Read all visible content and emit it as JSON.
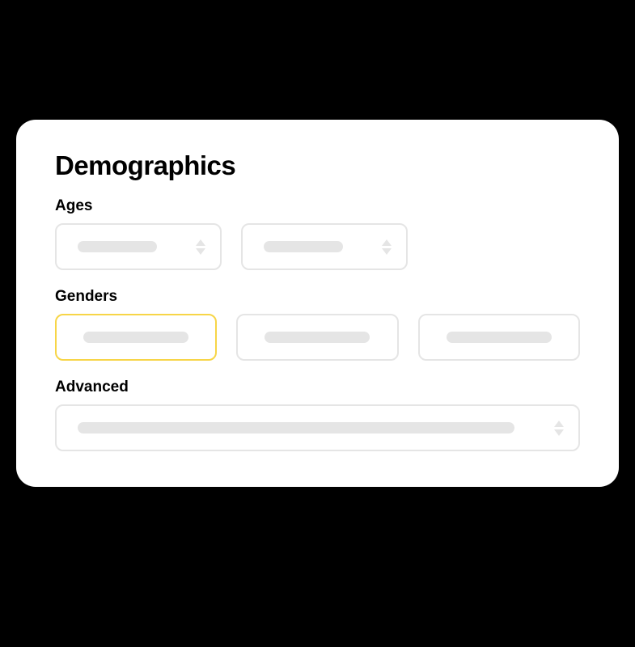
{
  "card": {
    "title": "Demographics",
    "sections": {
      "ages": {
        "label": "Ages"
      },
      "genders": {
        "label": "Genders"
      },
      "advanced": {
        "label": "Advanced"
      }
    }
  }
}
